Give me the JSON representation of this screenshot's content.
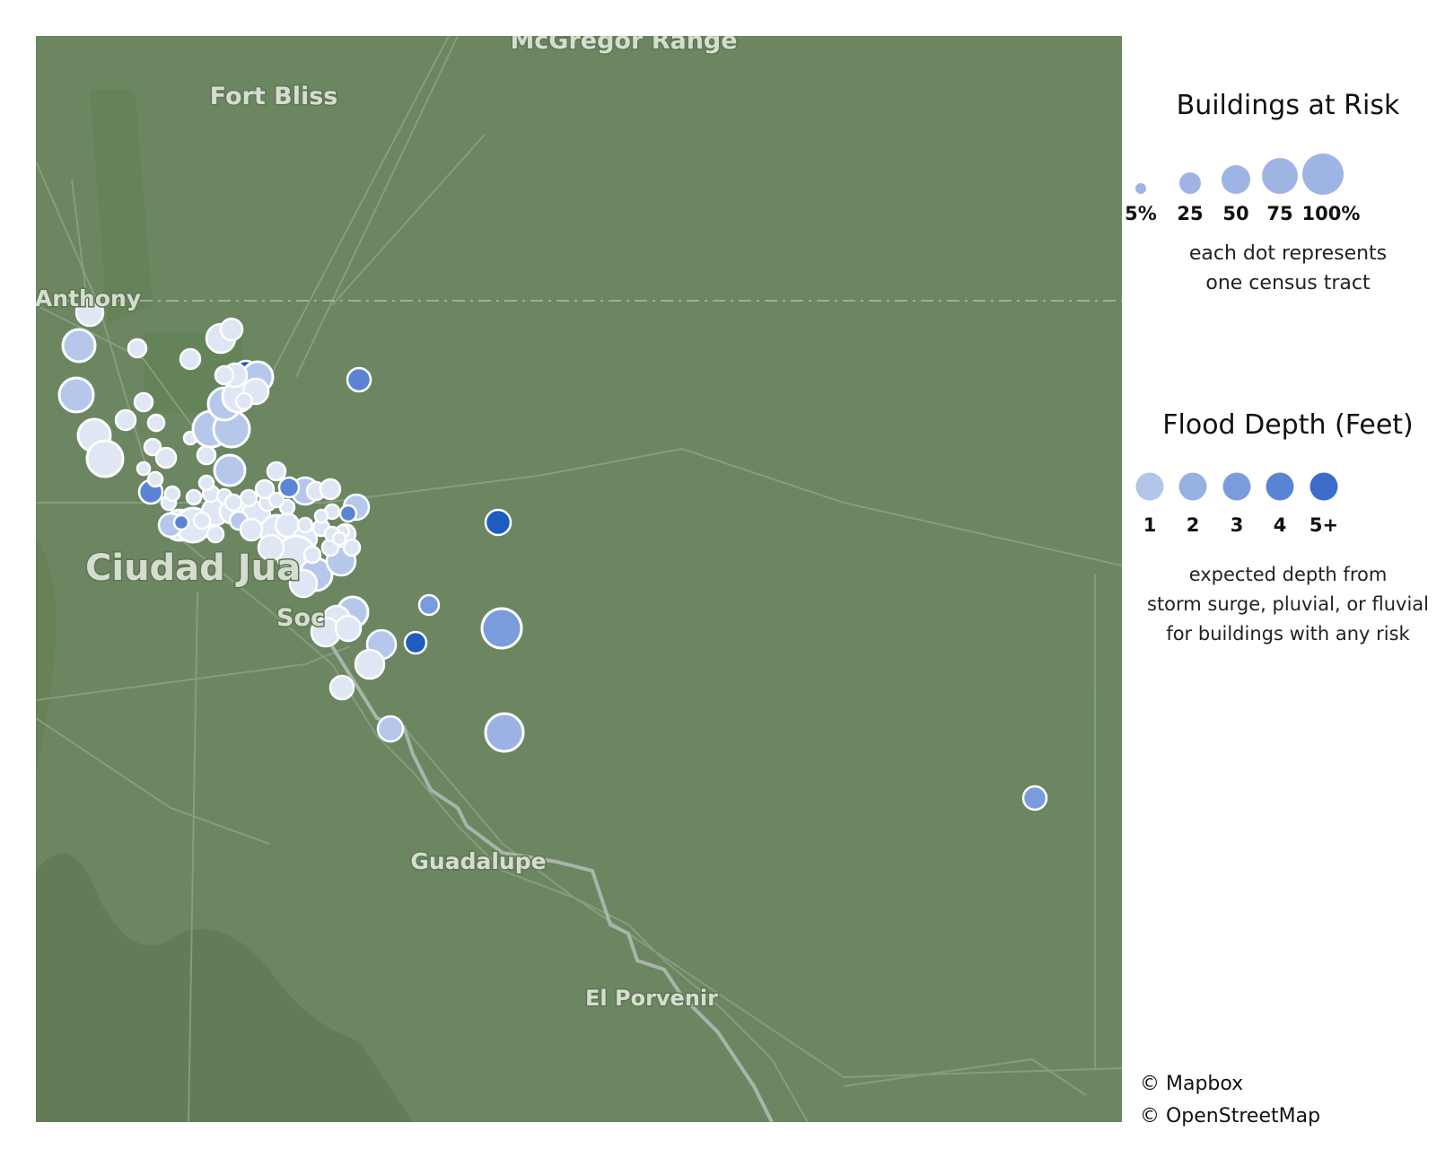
{
  "map": {
    "places": [
      {
        "label": "McGregor Range",
        "size": 27
      },
      {
        "label": "Fort Bliss",
        "size": 27
      },
      {
        "label": "Anthony",
        "size": 25
      },
      {
        "label": "Ciudad Jua",
        "size": 40
      },
      {
        "label": "Soc",
        "size": 27
      },
      {
        "label": "Guadalupe",
        "size": 25
      },
      {
        "label": "El Porvenir",
        "size": 24
      }
    ]
  },
  "legend": {
    "size": {
      "title": "Buildings at Risk",
      "items": [
        "5%",
        "25",
        "50",
        "75",
        "100%"
      ],
      "caption_line1": "each dot represents",
      "caption_line2": "one census tract"
    },
    "depth": {
      "title": "Flood Depth (Feet)",
      "items": [
        "1",
        "2",
        "3",
        "4",
        "5+"
      ],
      "colors": [
        "#b3c6ea",
        "#98b1e3",
        "#7b9cdc",
        "#5b84d4",
        "#3d6ccb"
      ],
      "caption_line1": "expected depth from",
      "caption_line2": "storm surge, pluvial, or fluvial",
      "caption_line3": "for buildings with any risk"
    }
  },
  "credits": {
    "mapbox": "© Mapbox",
    "osm": "© OpenStreetMap"
  }
}
